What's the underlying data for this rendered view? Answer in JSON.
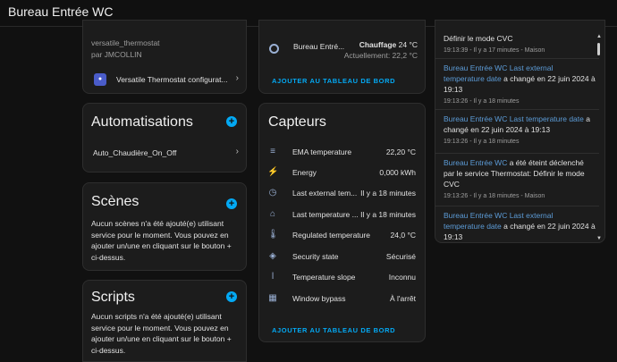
{
  "app": {
    "title": "Bureau Entrée WC"
  },
  "device": {
    "model": "versatile_thermostat",
    "manufacturer": "par JMCOLLIN",
    "integration": "Versatile Thermostat configurat..."
  },
  "controls": {
    "name": "Bureau Entré...",
    "mode": "Chauffage",
    "target": "24 °C",
    "current": "Actuellement: 22,2 °C",
    "add_button": "AJOUTER AU TABLEAU DE BORD"
  },
  "automations": {
    "title": "Automatisations",
    "items": [
      {
        "label": "Auto_Chaudière_On_Off"
      }
    ]
  },
  "scenes": {
    "title": "Scènes",
    "description": "Aucun scènes n'a été ajouté(e) utilisant service pour le moment. Vous pouvez en ajouter un/une en cliquant sur le bouton + ci-dessus."
  },
  "scripts": {
    "title": "Scripts",
    "description": "Aucun scripts n'a été ajouté(e) utilisant service pour le moment. Vous pouvez en ajouter un/une en cliquant sur le bouton + ci-dessus."
  },
  "sensors": {
    "title": "Capteurs",
    "add_button": "AJOUTER AU TABLEAU DE BORD",
    "rows": [
      {
        "icon": "thermometer-lines-icon",
        "glyph": "≡",
        "name": "EMA temperature",
        "value": "22,20 °C"
      },
      {
        "icon": "flash-icon",
        "glyph": "⚡",
        "name": "Energy",
        "value": "0,000 kWh"
      },
      {
        "icon": "clock-alert-icon",
        "glyph": "◷",
        "name": "Last external tem...",
        "value": "Il y a 18 minutes"
      },
      {
        "icon": "home-clock-icon",
        "glyph": "⌂",
        "name": "Last temperature ...",
        "value": "Il y a 18 minutes"
      },
      {
        "icon": "thermometer-auto-icon",
        "glyph": "🌡",
        "name": "Regulated temperature",
        "value": "24,0 °C"
      },
      {
        "icon": "shield-check-icon",
        "glyph": "◈",
        "name": "Security state",
        "value": "Sécurisé"
      },
      {
        "icon": "thermometer-icon",
        "glyph": "ǀ",
        "name": "Temperature slope",
        "value": "Inconnu"
      },
      {
        "icon": "window-icon",
        "glyph": "▦",
        "name": "Window bypass",
        "value": "À l'arrêt"
      }
    ]
  },
  "logbook": {
    "entries": [
      {
        "who": "",
        "text": "Définir le mode CVC",
        "meta": "19:13:39 - Il y a 17 minutes - Maison"
      },
      {
        "who": "Bureau Entrée WC Last external temperature date",
        "text": "a changé en 22 juin 2024 à 19:13",
        "meta": "19:13:26 - Il y a 18 minutes"
      },
      {
        "who": "Bureau Entrée WC Last temperature date",
        "text": "a changé en 22 juin 2024 à 19:13",
        "meta": "19:13:26 - Il y a 18 minutes"
      },
      {
        "who": "Bureau Entrée WC",
        "text": "a été éteint déclenché par le service Thermostat: Définir le mode CVC",
        "meta": "19:13:26 - Il y a 18 minutes - Maison"
      },
      {
        "who": "Bureau Entrée WC Last external temperature date",
        "text": "a changé en 22 juin 2024 à 19:13",
        "meta": ""
      }
    ]
  },
  "colors": {
    "accent": "#03a9f4",
    "card": "#1c1c1c",
    "background": "#111111"
  }
}
